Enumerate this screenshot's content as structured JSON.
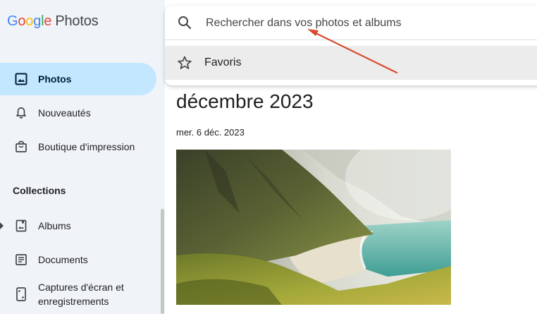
{
  "app": {
    "logo_letters": [
      "G",
      "o",
      "o",
      "g",
      "l",
      "e"
    ],
    "logo_word": "Photos"
  },
  "sidebar": {
    "items": [
      {
        "label": "Photos",
        "icon": "photo-icon",
        "active": true
      },
      {
        "label": "Nouveautés",
        "icon": "bell-icon",
        "active": false
      },
      {
        "label": "Boutique d'impression",
        "icon": "shopping-bag-icon",
        "active": false
      }
    ],
    "collections_header": "Collections",
    "collections": [
      {
        "label": "Albums",
        "icon": "album-icon"
      },
      {
        "label": "Documents",
        "icon": "document-icon"
      },
      {
        "label_line1": "Captures d'écran et",
        "label_line2": "enregistrements",
        "icon": "phone-screenshot-icon"
      }
    ]
  },
  "search": {
    "placeholder": "Rechercher dans vos photos et albums",
    "suggestions": [
      {
        "label": "Favoris",
        "icon": "star-icon"
      }
    ]
  },
  "main": {
    "month_title": "décembre 2023",
    "date_label": "mer. 6 déc. 2023"
  },
  "colors": {
    "accent_active": "#c2e7ff",
    "annotation_arrow": "#d94b2b",
    "background": "#f0f4f9"
  }
}
